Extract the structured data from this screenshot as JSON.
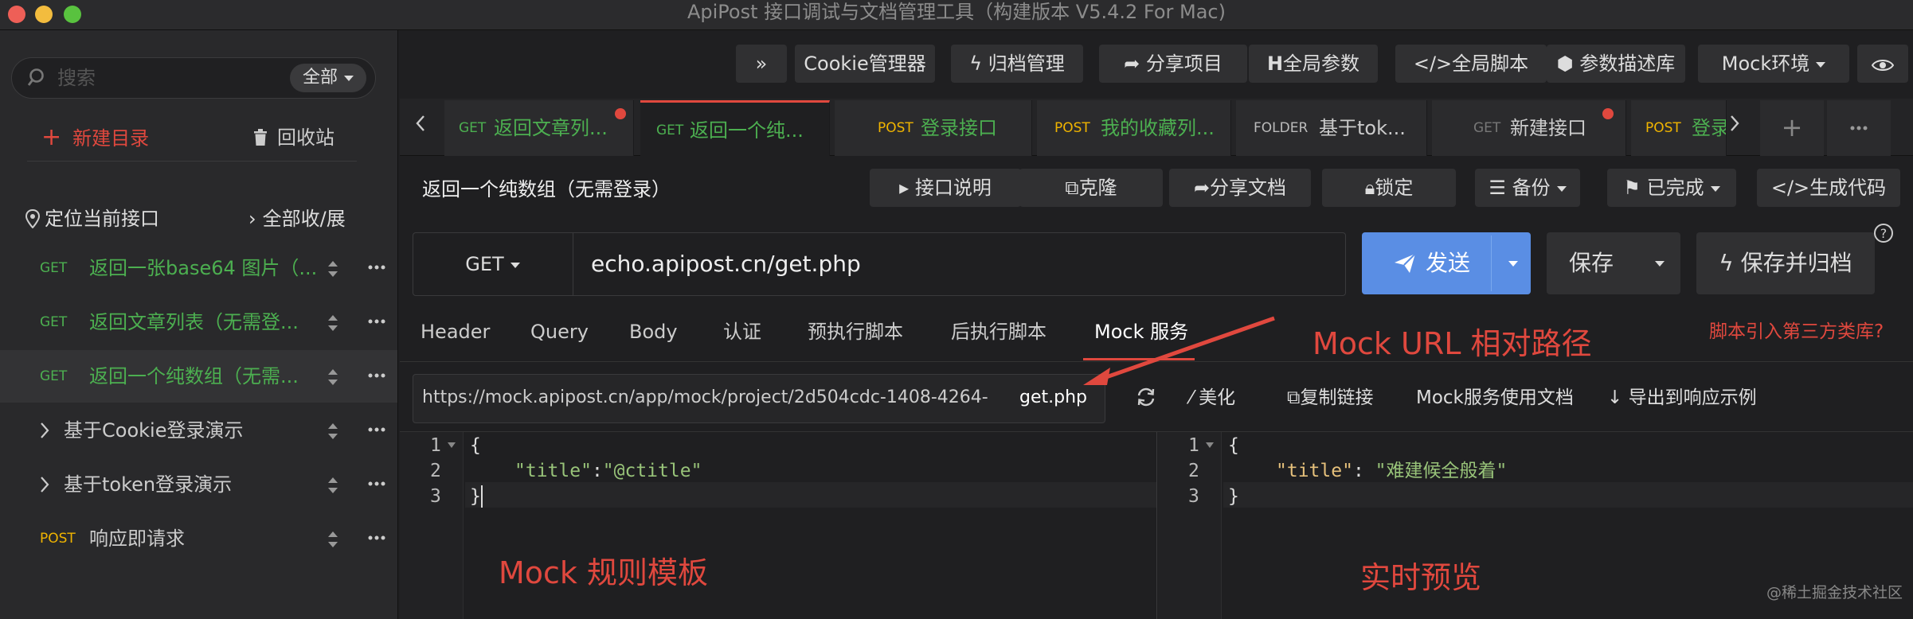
{
  "window": {
    "title": "ApiPost 接口调试与文档管理工具（构建版本 V5.4.2 For Mac)"
  },
  "sidebar": {
    "search_placeholder": "搜索",
    "scope": "全部",
    "new_dir": "新建目录",
    "recycle": "回收站",
    "locate": "定位当前接口",
    "collapse": "全部收/展",
    "items": [
      {
        "method": "GET",
        "label": "返回一张base64 图片（..."
      },
      {
        "method": "GET",
        "label": "返回文章列表（无需登..."
      },
      {
        "method": "GET",
        "label": "返回一个纯数组（无需..."
      },
      {
        "label": "基于Cookie登录演示"
      },
      {
        "label": "基于token登录演示"
      },
      {
        "method": "POST",
        "label": "响应即请求"
      }
    ]
  },
  "toolbar": {
    "expand": "»",
    "cookie": "Cookie管理器",
    "archive": "归档管理",
    "share_project": "分享项目",
    "global_params": "全局参数",
    "global_script": "全局脚本",
    "param_lib": "参数描述库",
    "mock_env": "Mock环境"
  },
  "tabs": [
    {
      "method": "GET",
      "label": "返回文章列...",
      "dot": true
    },
    {
      "method": "GET",
      "label": "返回一个纯...",
      "dot": false,
      "active": true
    },
    {
      "method": "POST",
      "label": "登录接口",
      "dot": false
    },
    {
      "method": "POST",
      "label": "我的收藏列...",
      "dot": false
    },
    {
      "method": "FOLDER",
      "label": "基于tok...",
      "dot": false
    },
    {
      "method": "GET",
      "label": "新建接口",
      "dot": true
    },
    {
      "method": "POST",
      "label": "登录",
      "dot": false
    }
  ],
  "request": {
    "title": "返回一个纯数组（无需登录）",
    "actions": {
      "doc": "接口说明",
      "clone": "克隆",
      "share_doc": "分享文档",
      "lock": "锁定",
      "backup": "备份",
      "done": "已完成",
      "gen_code": "生成代码"
    },
    "method": "GET",
    "url": "echo.apipost.cn/get.php",
    "send": "发送",
    "save": "保存",
    "save_archive": "保存并归档"
  },
  "subtabs": {
    "header": "Header",
    "query": "Query",
    "body": "Body",
    "auth": "认证",
    "pre_script": "预执行脚本",
    "post_script": "后执行脚本",
    "mock": "Mock 服务",
    "script_lib": "脚本引入第三方类库?"
  },
  "mock": {
    "url": "https://mock.apipost.cn/app/mock/project/2d504cdc-1408-4264-",
    "suffix": "get.php",
    "beautify": "美化",
    "copy_link": "复制链接",
    "docs": "Mock服务使用文档",
    "export": "导出到响应示例"
  },
  "editor_left": {
    "lines": [
      "1",
      "2",
      "3"
    ],
    "line1": "{",
    "line2_key": "\"title\"",
    "line2_sep": ":",
    "line2_val": "\"@ctitle\"",
    "line3": "}"
  },
  "editor_right": {
    "lines": [
      "1",
      "2",
      "3"
    ],
    "line1": "{",
    "line2_key": "\"title\"",
    "line2_sep": ": ",
    "line2_val": "\"难建候全般着\"",
    "line3": "}"
  },
  "annotations": {
    "relative_path": "Mock URL 相对路径",
    "rule_template": "Mock 规则模板",
    "preview": "实时预览"
  },
  "watermark": "@稀土掘金技术社区",
  "colors": {
    "accent": "#e0483e",
    "get": "#4caf50",
    "post": "#f0b400",
    "send": "#5a8ee4"
  }
}
